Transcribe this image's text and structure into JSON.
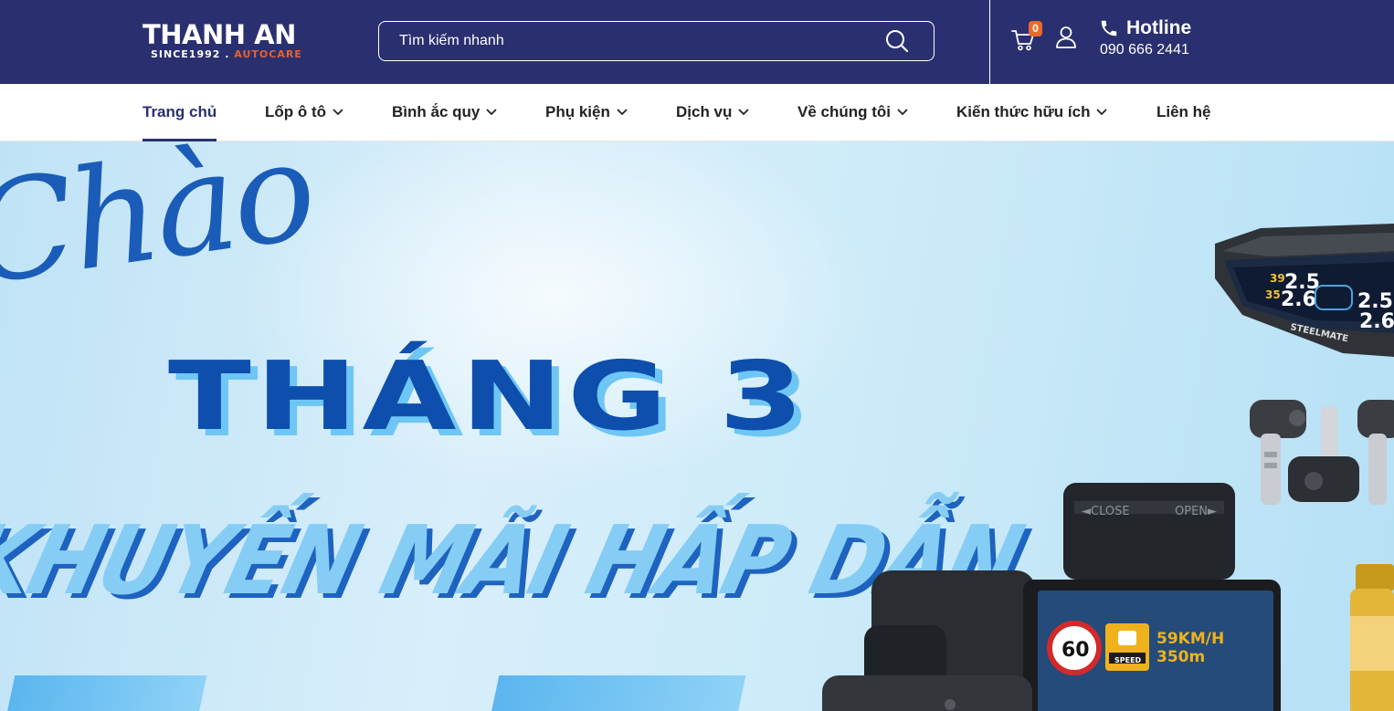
{
  "header": {
    "logo_main": "THANH AN",
    "logo_since": "SINCE1992 .",
    "logo_tag": "AUTOCARE",
    "search_placeholder": "Tìm kiếm nhanh",
    "cart_count": "0",
    "hotline_label": "Hotline",
    "hotline_number": "090 666 2441",
    "icons": [
      "search-icon",
      "cart-icon",
      "user-icon",
      "phone-icon"
    ]
  },
  "nav": {
    "items": [
      {
        "label": "Trang chủ",
        "active": true,
        "has_dropdown": false
      },
      {
        "label": "Lốp ô tô",
        "active": false,
        "has_dropdown": true
      },
      {
        "label": "Bình ắc quy",
        "active": false,
        "has_dropdown": true
      },
      {
        "label": "Phụ kiện",
        "active": false,
        "has_dropdown": true
      },
      {
        "label": "Dịch vụ",
        "active": false,
        "has_dropdown": true
      },
      {
        "label": "Về chúng tôi",
        "active": false,
        "has_dropdown": true
      },
      {
        "label": "Kiến thức hữu ích",
        "active": false,
        "has_dropdown": true
      },
      {
        "label": "Liên hệ",
        "active": false,
        "has_dropdown": false
      }
    ]
  },
  "banner": {
    "script_text": "Chào",
    "headline": "THÁNG 3",
    "subheadline": "KHUYẾN MÃI HẤP DẪN",
    "tpms_values": [
      "39",
      "2.5",
      "35",
      "2.6",
      "2.5",
      "2.6"
    ],
    "tpms_brand": "STEELMATE",
    "dashcam_close": "◄CLOSE",
    "dashcam_open": "OPEN►",
    "speed_limit": "60",
    "speed_readout": "59KM/H",
    "distance_readout": "350m",
    "speed_label": "SPEED"
  },
  "colors": {
    "header_bg": "#2a306f",
    "badge": "#ea6a2b",
    "headline_blue": "#0e4fae",
    "light_blue": "#86cdf5"
  }
}
